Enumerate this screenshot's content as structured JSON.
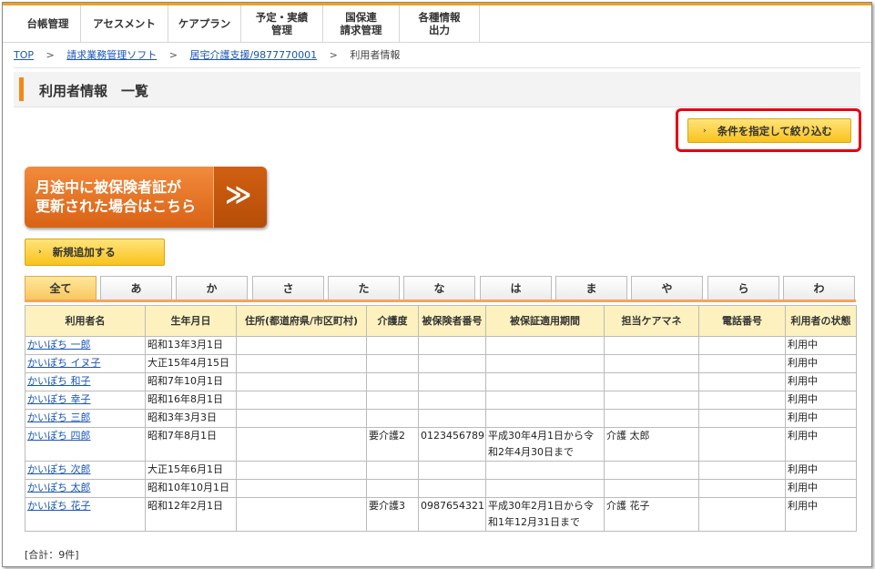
{
  "nav": [
    {
      "label": "台帳管理"
    },
    {
      "label": "アセスメント"
    },
    {
      "label": "ケアプラン"
    },
    {
      "label": "予定・実績\n管理"
    },
    {
      "label": "国保連\n請求管理"
    },
    {
      "label": "各種情報\n出力"
    }
  ],
  "breadcrumb": {
    "top": "TOP",
    "sep": ">",
    "level1": "請求業務管理ソフト",
    "level2": "居宅介護支援/9877770001",
    "current": "利用者情報"
  },
  "page_title": "利用者情報　一覧",
  "filter_button": "条件を指定して絞り込む",
  "banner_text": "月途中に被保険者証が\n更新された場合はこちら",
  "banner_arrow": "≫",
  "add_button": "新規追加する",
  "chevron": "›",
  "tabs": [
    "全て",
    "あ",
    "か",
    "さ",
    "た",
    "な",
    "は",
    "ま",
    "や",
    "ら",
    "わ"
  ],
  "columns": [
    "利用者名",
    "生年月日",
    "住所(都道府県/市区町村)",
    "介護度",
    "被保険者番号",
    "被保証適用期間",
    "担当ケアマネ",
    "電話番号",
    "利用者の状態"
  ],
  "rows": [
    {
      "name": "かいぽち 一郎",
      "birth": "昭和13年3月1日",
      "address": "",
      "care_level": "",
      "insured_no": "",
      "period": "",
      "manager": "",
      "phone": "",
      "status": "利用中"
    },
    {
      "name": "かいぽち イヌ子",
      "birth": "大正15年4月15日",
      "address": "",
      "care_level": "",
      "insured_no": "",
      "period": "",
      "manager": "",
      "phone": "",
      "status": "利用中"
    },
    {
      "name": "かいぽち 和子",
      "birth": "昭和7年10月1日",
      "address": "",
      "care_level": "",
      "insured_no": "",
      "period": "",
      "manager": "",
      "phone": "",
      "status": "利用中"
    },
    {
      "name": "かいぽち 幸子",
      "birth": "昭和16年8月1日",
      "address": "",
      "care_level": "",
      "insured_no": "",
      "period": "",
      "manager": "",
      "phone": "",
      "status": "利用中"
    },
    {
      "name": "かいぽち 三郎",
      "birth": "昭和3年3月3日",
      "address": "",
      "care_level": "",
      "insured_no": "",
      "period": "",
      "manager": "",
      "phone": "",
      "status": "利用中"
    },
    {
      "name": "かいぽち 四郎",
      "birth": "昭和7年8月1日",
      "address": "",
      "care_level": "要介護2",
      "insured_no": "0123456789",
      "period": "平成30年4月1日から令\n和2年4月30日まで",
      "manager": "介護 太郎",
      "phone": "",
      "status": "利用中"
    },
    {
      "name": "かいぽち 次郎",
      "birth": "大正15年6月1日",
      "address": "",
      "care_level": "",
      "insured_no": "",
      "period": "",
      "manager": "",
      "phone": "",
      "status": "利用中"
    },
    {
      "name": "かいぽち 太郎",
      "birth": "昭和10年10月1日",
      "address": "",
      "care_level": "",
      "insured_no": "",
      "period": "",
      "manager": "",
      "phone": "",
      "status": "利用中"
    },
    {
      "name": "かいぽち 花子",
      "birth": "昭和12年2月1日",
      "address": "",
      "care_level": "要介護3",
      "insured_no": "0987654321",
      "period": "平成30年2月1日から令\n和1年12月31日まで",
      "manager": "介護 花子",
      "phone": "",
      "status": "利用中"
    }
  ],
  "total": "[合計：9件]"
}
